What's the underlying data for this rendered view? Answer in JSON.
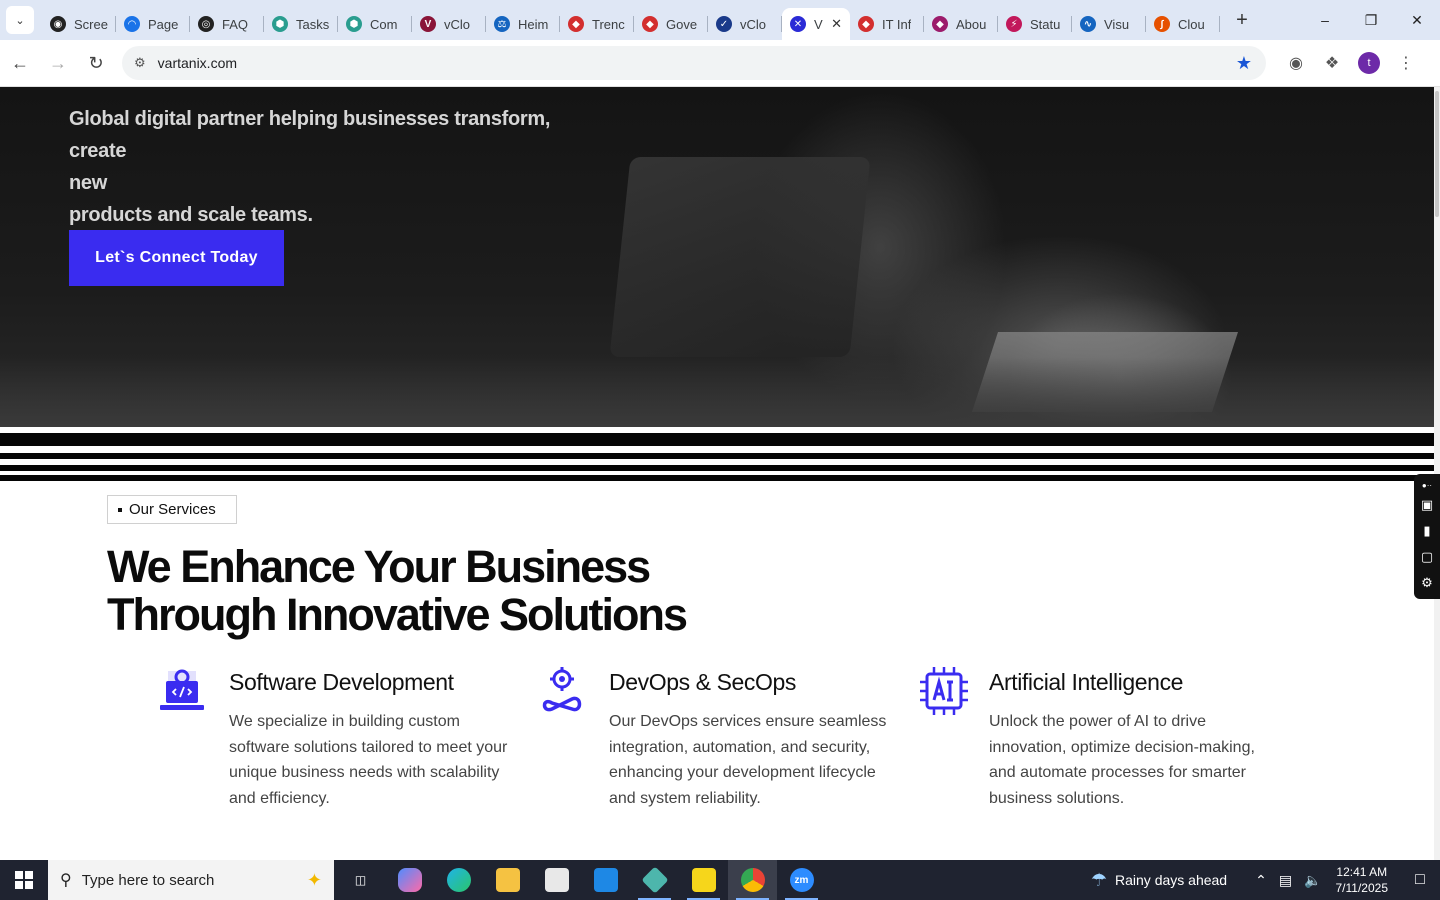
{
  "browser": {
    "tabs": [
      {
        "label": "Scree",
        "color": "#222222",
        "glyph": "◉"
      },
      {
        "label": "Page",
        "color": "#1a73e8",
        "glyph": "◠"
      },
      {
        "label": "FAQ",
        "color": "#222222",
        "glyph": "◎"
      },
      {
        "label": "Tasks",
        "color": "#2a9d8f",
        "glyph": "⬢"
      },
      {
        "label": "Com",
        "color": "#2a9d8f",
        "glyph": "⬢"
      },
      {
        "label": "vClo",
        "color": "#8a1538",
        "glyph": "V"
      },
      {
        "label": "Heim",
        "color": "#1565c0",
        "glyph": "⚖"
      },
      {
        "label": "Trenc",
        "color": "#d32f2f",
        "glyph": "◆"
      },
      {
        "label": "Gove",
        "color": "#d32f2f",
        "glyph": "◆"
      },
      {
        "label": "vClo",
        "color": "#1a3a8a",
        "glyph": "✓"
      },
      {
        "label": "V",
        "color": "#2b2bd6",
        "glyph": "✕",
        "active": true
      },
      {
        "label": "IT Inf",
        "color": "#d32f2f",
        "glyph": "◆"
      },
      {
        "label": "Abou",
        "color": "#9c1b6b",
        "glyph": "◆"
      },
      {
        "label": "Statu",
        "color": "#c2185b",
        "glyph": "⚡"
      },
      {
        "label": "Visu",
        "color": "#1565c0",
        "glyph": "∿"
      },
      {
        "label": "Clou",
        "color": "#e65100",
        "glyph": "∫"
      }
    ],
    "url": "vartanix.com",
    "profile_initial": "t"
  },
  "hero": {
    "tagline": "Global digital partner helping businesses transform, create new products and scale teams.",
    "tagline_line1": "Global digital partner helping businesses transform, create",
    "tagline_line2": "new",
    "tagline_line3": "products and scale teams.",
    "cta_label": "Let`s Connect Today"
  },
  "services": {
    "badge": "Our Services",
    "headline_line1": "We Enhance Your Business",
    "headline_line2": "Through Innovative Solutions",
    "cards": [
      {
        "icon": "laptop-code-icon",
        "title": "Software Development",
        "description": "We specialize in building custom software solutions tailored to meet your unique business needs with scalability and efficiency."
      },
      {
        "icon": "devops-infinity-gear-icon",
        "title": "DevOps & SecOps",
        "description": "Our DevOps services ensure seamless integration, automation, and security, enhancing your development lifecycle and system reliability."
      },
      {
        "icon": "ai-chip-icon",
        "title": "Artificial Intelligence",
        "description": "Unlock the power of AI to drive innovation, optimize decision-making, and automate processes for smarter business solutions."
      }
    ],
    "accent_color": "#3a2cf0"
  },
  "taskbar": {
    "search_placeholder": "Type here to search",
    "weather": "Rainy days ahead",
    "time": "12:41 AM",
    "date": "7/11/2025"
  }
}
